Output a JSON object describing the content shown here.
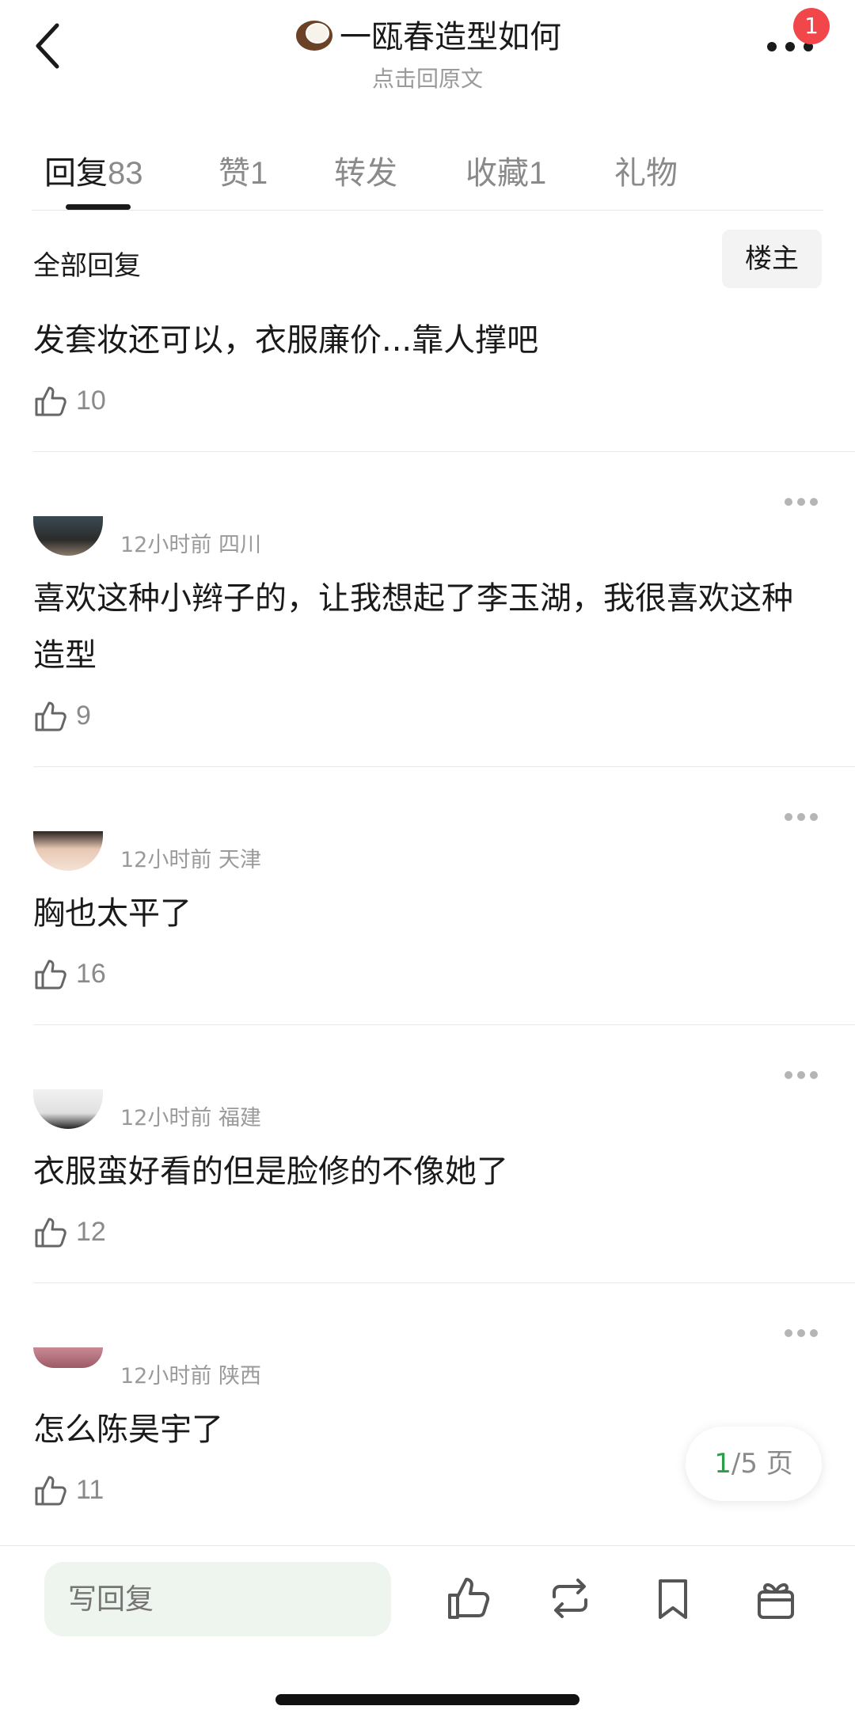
{
  "header": {
    "title": "一瓯春造型如何",
    "subtitle": "点击回原文",
    "notification_count": "1"
  },
  "tabs": [
    {
      "label": "回复",
      "count": "83"
    },
    {
      "label": "赞",
      "count": "1"
    },
    {
      "label": "转发",
      "count": ""
    },
    {
      "label": "收藏",
      "count": "1"
    },
    {
      "label": "礼物",
      "count": ""
    }
  ],
  "filter": {
    "label": "全部回复",
    "louzhu": "楼主"
  },
  "comments": [
    {
      "text": "发套妆还可以，衣服廉价...靠人撑吧",
      "likes": "10",
      "time": "",
      "location": ""
    },
    {
      "text": "喜欢这种小辫子的，让我想起了李玉湖，我很喜欢这种造型",
      "likes": "9",
      "time": "12小时前",
      "location": "四川"
    },
    {
      "text": "胸也太平了",
      "likes": "16",
      "time": "12小时前",
      "location": "天津"
    },
    {
      "text": "衣服蛮好看的但是脸修的不像她了",
      "likes": "12",
      "time": "12小时前",
      "location": "福建"
    },
    {
      "text": "怎么陈昊宇了",
      "likes": "11",
      "time": "12小时前",
      "location": "陕西"
    }
  ],
  "pager": {
    "current": "1",
    "total_text": "/5 页"
  },
  "bottom": {
    "reply_placeholder": "写回复"
  },
  "colors": {
    "accent": "#2e9c4a",
    "badge": "#f2474a",
    "input_bg": "#eef5ef"
  }
}
